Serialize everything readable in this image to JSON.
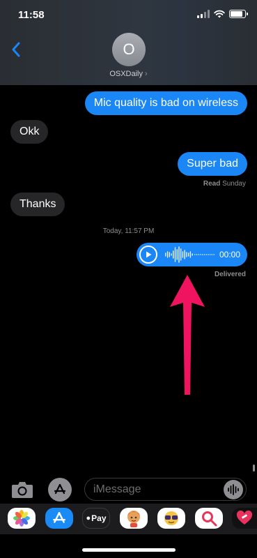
{
  "status": {
    "time": "11:58",
    "battery_percent": 85
  },
  "header": {
    "avatar_initial": "O",
    "contact_name": "OSXDaily",
    "chevron": "›",
    "back_icon": "chevron-left-icon"
  },
  "messages": [
    {
      "direction": "out",
      "text": "Mic quality is bad on wireless"
    },
    {
      "direction": "in",
      "text": "Okk"
    },
    {
      "direction": "out",
      "text": "Super bad"
    },
    {
      "direction": "in",
      "text": "Thanks"
    }
  ],
  "read_receipt": {
    "label": "Read",
    "when": "Sunday"
  },
  "timestamp": "Today, 11:57 PM",
  "audio_message": {
    "duration": "00:00",
    "status": "Delivered"
  },
  "input": {
    "placeholder": "iMessage"
  },
  "app_strip": [
    "photos-icon",
    "app-store-icon",
    "apple-pay-icon",
    "memoji-icon",
    "memoji-sunglasses-icon",
    "image-search-icon",
    "heart-sticker-icon"
  ],
  "app_strip_labels": {
    "apple_pay": "Pay"
  },
  "colors": {
    "accent": "#1b86f6",
    "arrow": "#f0135f",
    "incoming_bubble": "#262628"
  }
}
